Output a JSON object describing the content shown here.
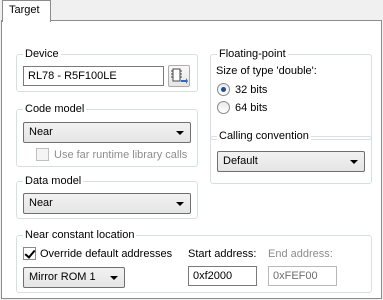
{
  "tab": {
    "label": "Target"
  },
  "device": {
    "title": "Device",
    "value": "RL78 - R5F100LE",
    "icon": "device-select-icon"
  },
  "code_model": {
    "title": "Code model",
    "selected": "Near",
    "far_runtime_label": "Use far runtime library calls",
    "far_runtime_checked": false
  },
  "data_model": {
    "title": "Data model",
    "selected": "Near"
  },
  "floating_point": {
    "title": "Floating-point",
    "size_label": "Size of type 'double':",
    "options": [
      "32 bits",
      "64 bits"
    ],
    "selected_index": 0
  },
  "calling_convention": {
    "title": "Calling convention",
    "selected": "Default"
  },
  "near_constant": {
    "title": "Near constant location",
    "override_label": "Override default addresses",
    "override_checked": true,
    "mirror_selected": "Mirror ROM 1",
    "start_label": "Start address:",
    "start_value": "0xf2000",
    "end_label": "End address:",
    "end_value": "0xFEF00"
  }
}
